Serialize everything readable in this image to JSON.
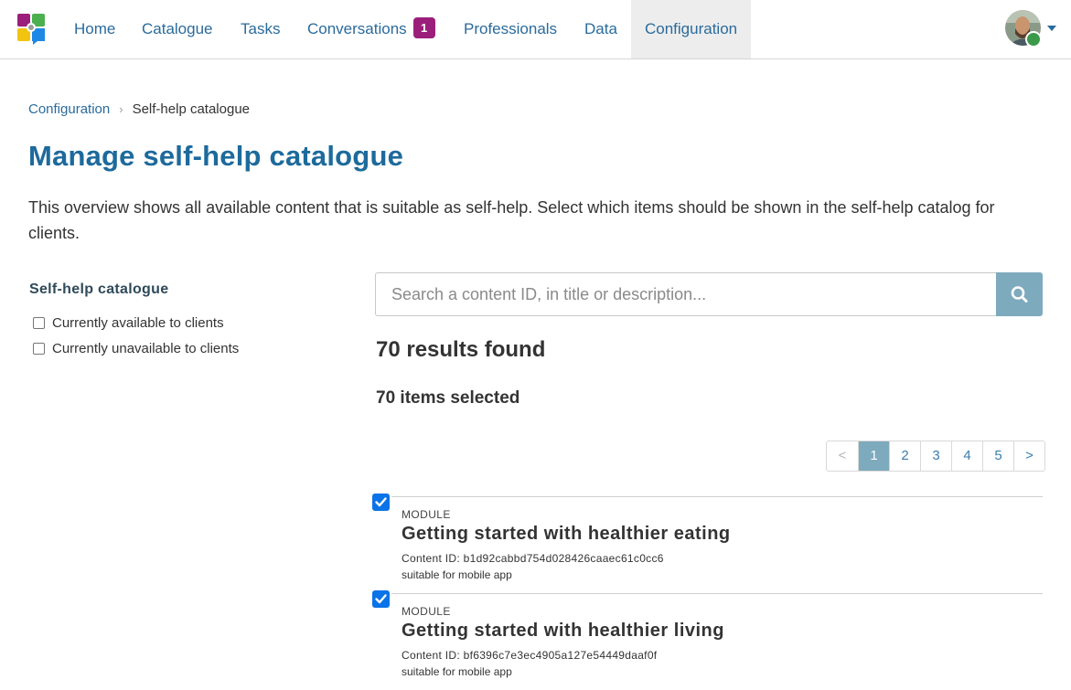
{
  "nav": {
    "items": [
      {
        "label": "Home"
      },
      {
        "label": "Catalogue"
      },
      {
        "label": "Tasks"
      },
      {
        "label": "Conversations",
        "badge": "1"
      },
      {
        "label": "Professionals"
      },
      {
        "label": "Data"
      },
      {
        "label": "Configuration",
        "active": true
      }
    ],
    "logo_icon": "app-logo-icon",
    "avatar_icon": "user-avatar",
    "menu_icon": "caret-down-icon"
  },
  "breadcrumb": {
    "parent": "Configuration",
    "current": "Self-help catalogue"
  },
  "page": {
    "title": "Manage self-help catalogue",
    "intro": "This overview shows all available content that is suitable as self-help. Select which items should be shown in the self-help catalog for clients."
  },
  "filters": {
    "title": "Self-help catalogue",
    "options": [
      {
        "label": "Currently available to clients",
        "checked": false
      },
      {
        "label": "Currently unavailable to clients",
        "checked": false
      }
    ]
  },
  "search": {
    "placeholder": "Search a content ID, in title or description...",
    "value": "",
    "button_icon": "search-icon"
  },
  "results": {
    "count_text": "70 results found",
    "selected_text": "70 items selected"
  },
  "pagination": {
    "prev": "<",
    "pages": [
      "1",
      "2",
      "3",
      "4",
      "5"
    ],
    "current": "1",
    "next": ">"
  },
  "items": [
    {
      "type": "MODULE",
      "title": "Getting started with healthier eating",
      "content_id": "Content ID: b1d92cabbd754d028426caaec61c0cc6",
      "note": "suitable for mobile app",
      "checked": true
    },
    {
      "type": "MODULE",
      "title": "Getting started with healthier living",
      "content_id": "Content ID: bf6396c7e3ec4905a127e54449daaf0f",
      "note": "suitable for mobile app",
      "checked": true
    }
  ],
  "colors": {
    "nav_link": "#2a6b9c",
    "title": "#1d6a9c",
    "badge": "#9b1f7a",
    "accent": "#7eaabd",
    "checkbox": "#0a73e8"
  }
}
